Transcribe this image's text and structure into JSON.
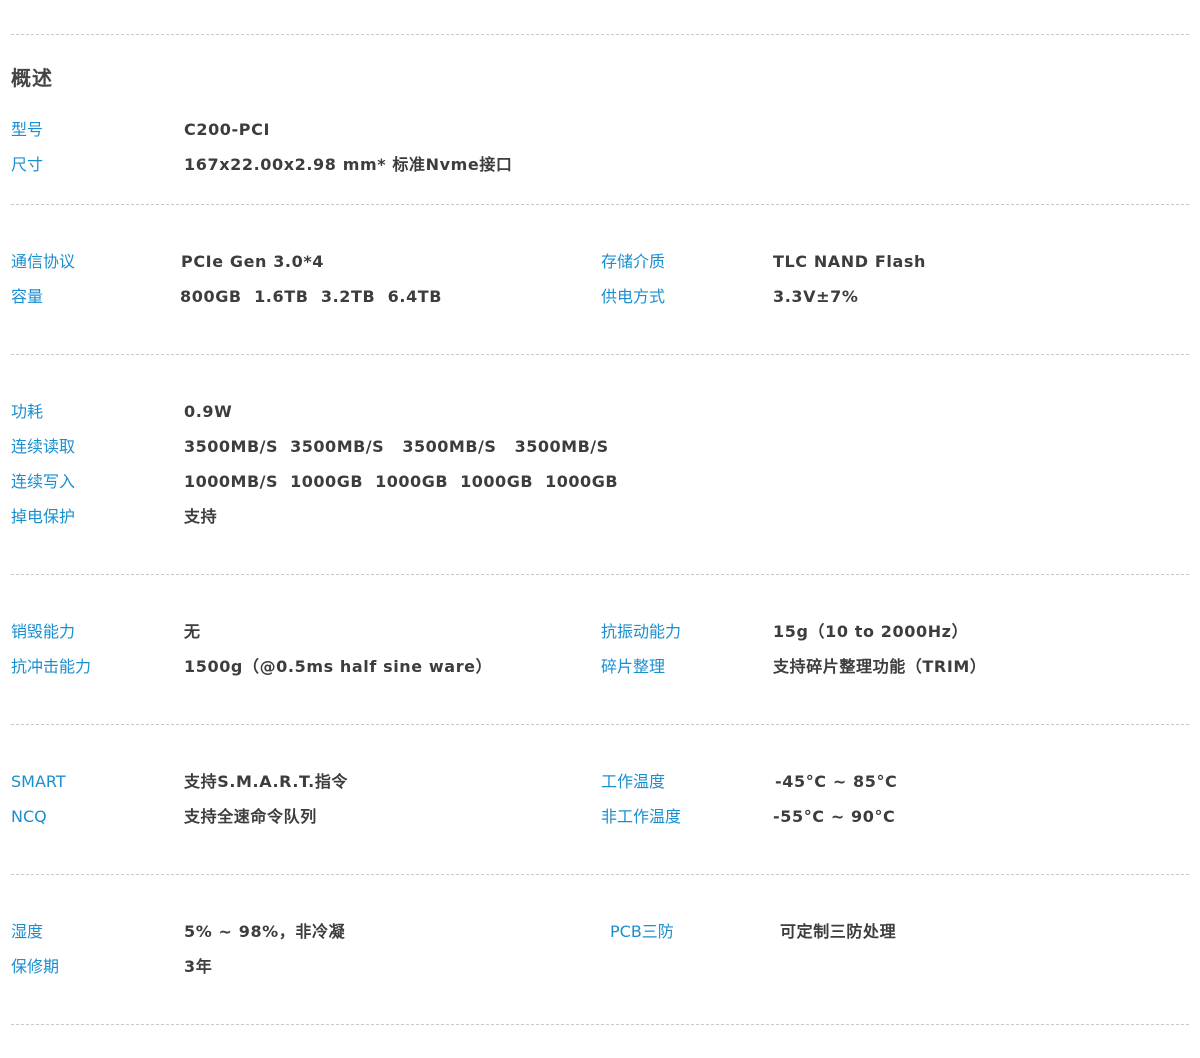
{
  "overview": {
    "title": "概述"
  },
  "sections": {
    "s1": {
      "model_label": "型号",
      "model_value": "C200-PCI",
      "size_label": "尺寸",
      "size_value": "167x22.00x2.98 mm* 标准Nvme接口"
    },
    "s2": {
      "protocol_label": "通信协议",
      "protocol_value": "PCIe Gen 3.0*4",
      "capacity_label": "容量",
      "capacity_value": "800GB  1.6TB  3.2TB  6.4TB",
      "media_label": "存储介质",
      "media_value": "TLC NAND Flash",
      "power_supply_label": "供电方式",
      "power_supply_value": "3.3V±7%"
    },
    "s3": {
      "consumption_label": "功耗",
      "consumption_value": "0.9W",
      "seq_read_label": "连续读取",
      "seq_read_value": "3500MB/S  3500MB/S   3500MB/S   3500MB/S",
      "seq_write_label": "连续写入",
      "seq_write_value": "1000MB/S  1000GB  1000GB  1000GB  1000GB",
      "plp_label": "掉电保护",
      "plp_value": "支持"
    },
    "s4": {
      "destroy_label": "销毁能力",
      "destroy_value": "无",
      "shock_label": "抗冲击能力",
      "shock_value": "1500g（@0.5ms half sine ware）",
      "vibration_label": "抗振动能力",
      "vibration_value": "15g（10 to 2000Hz）",
      "trim_label": "碎片整理",
      "trim_value": "支持碎片整理功能（TRIM）"
    },
    "s5": {
      "smart_label": "SMART",
      "smart_value": "支持S.M.A.R.T.指令",
      "ncq_label": "NCQ",
      "ncq_value": "支持全速命令队列",
      "op_temp_label": "工作温度",
      "op_temp_value": "-45°C ~ 85°C",
      "nonop_temp_label": "非工作温度",
      "nonop_temp_value": "-55°C ~ 90°C"
    },
    "s6": {
      "humidity_label": "湿度",
      "humidity_value": "5% ~ 98%，非冷凝",
      "warranty_label": "保修期",
      "warranty_value": "3年",
      "pcb_label": "PCB三防",
      "pcb_value": "可定制三防处理"
    }
  },
  "colors": {
    "label": "#1a8fd0",
    "value": "#3d3d3d",
    "title": "#444444",
    "divider": "#c9c9c9"
  }
}
